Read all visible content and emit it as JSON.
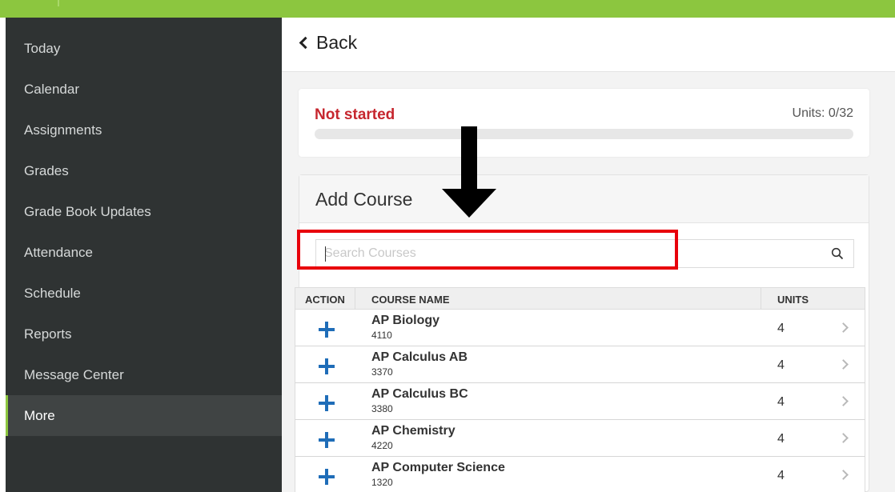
{
  "sidebar": {
    "items": [
      {
        "label": "Today"
      },
      {
        "label": "Calendar"
      },
      {
        "label": "Assignments"
      },
      {
        "label": "Grades"
      },
      {
        "label": "Grade Book Updates"
      },
      {
        "label": "Attendance"
      },
      {
        "label": "Schedule"
      },
      {
        "label": "Reports"
      },
      {
        "label": "Message Center"
      },
      {
        "label": "More",
        "active": true
      }
    ]
  },
  "header": {
    "back_label": "Back"
  },
  "status": {
    "label": "Not started",
    "units": "Units: 0/32",
    "progress": 0
  },
  "add_course": {
    "title": "Add Course",
    "search_placeholder": "Search Courses"
  },
  "table": {
    "headers": {
      "action": "ACTION",
      "course_name": "COURSE NAME",
      "units": "UNITS"
    },
    "rows": [
      {
        "name": "AP Biology",
        "number": "4110",
        "units": "4"
      },
      {
        "name": "AP Calculus AB",
        "number": "3370",
        "units": "4"
      },
      {
        "name": "AP Calculus BC",
        "number": "3380",
        "units": "4"
      },
      {
        "name": "AP Chemistry",
        "number": "4220",
        "units": "4"
      },
      {
        "name": "AP Computer Science",
        "number": "1320",
        "units": "4"
      }
    ]
  },
  "colors": {
    "accent_green": "#8cc63f",
    "status_red": "#c6262e",
    "action_blue": "#1f6db8",
    "highlight_red": "#e8000b"
  },
  "icons": {
    "search": "search-icon",
    "back": "chevron-left-icon",
    "row": "chevron-right-icon",
    "add": "plus-icon",
    "annotation": "down-arrow-icon"
  }
}
